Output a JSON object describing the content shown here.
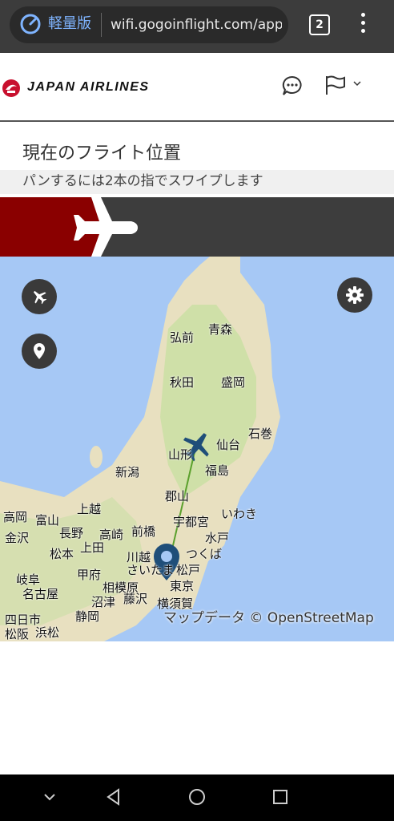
{
  "browser": {
    "lite_mode_label": "軽量版",
    "url": "wifi.gogoinflight.com/app",
    "tab_count": "2"
  },
  "header": {
    "brand": "JAPAN AIRLINES"
  },
  "page": {
    "title": "現在のフライト位置",
    "hint": "パンするには2本の指でスワイプします"
  },
  "map": {
    "cities": [
      "弘前",
      "青森",
      "秋田",
      "盛岡",
      "石巻",
      "山形",
      "仙台",
      "新潟",
      "福島",
      "郡山",
      "いわき",
      "上越",
      "高岡",
      "富山",
      "金沢",
      "長野",
      "宇都宮",
      "上田",
      "高崎",
      "前橋",
      "水戸",
      "松本",
      "つくば",
      "川越",
      "岐阜",
      "甲府",
      "さいたま",
      "松戸",
      "名古屋",
      "相模原",
      "東京",
      "沼津",
      "藤沢",
      "横須賀",
      "静岡",
      "四日市",
      "松阪",
      "浜松"
    ],
    "attribution": "マップデータ © OpenStreetMap",
    "route_color": "#5aa02c",
    "plane_color": "#1f4e79"
  },
  "colors": {
    "brand_red": "#8a0000",
    "banner_dark": "#3d3d3d",
    "water": "#a6c8f5"
  }
}
